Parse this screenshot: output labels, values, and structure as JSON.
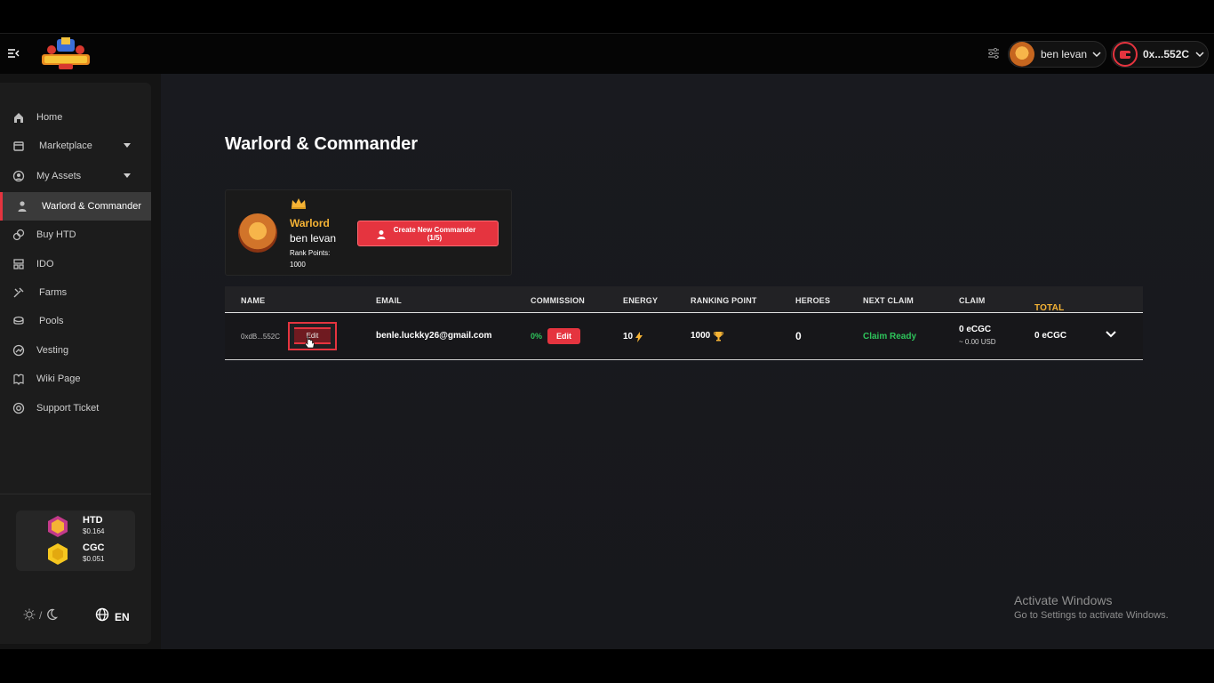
{
  "topbar": {
    "logo_text": "HEROES TD",
    "user_name": "ben levan",
    "wallet_address": "0x...552C"
  },
  "sidebar": {
    "items": [
      {
        "label": "Home",
        "icon": "home-icon"
      },
      {
        "label": "Marketplace",
        "icon": "store-icon"
      },
      {
        "label": "My Assets",
        "icon": "user-circle-icon"
      },
      {
        "label": "Warlord & Commander",
        "icon": "person-icon"
      },
      {
        "label": "Buy HTD",
        "icon": "coins-icon"
      },
      {
        "label": "IDO",
        "icon": "ido-icon"
      },
      {
        "label": "Farms",
        "icon": "tools-icon"
      },
      {
        "label": "Pools",
        "icon": "pool-icon"
      },
      {
        "label": "Vesting",
        "icon": "vesting-icon"
      },
      {
        "label": "Wiki Page",
        "icon": "book-icon"
      },
      {
        "label": "Support Ticket",
        "icon": "lifebuoy-icon"
      }
    ],
    "tokens": [
      {
        "name": "HTD",
        "price": "$0.164"
      },
      {
        "name": "CGC",
        "price": "$0.051"
      }
    ],
    "theme_separator": "/",
    "language": "EN"
  },
  "page": {
    "title": "Warlord & Commander"
  },
  "warlord_card": {
    "rank": "Warlord",
    "user_name": "ben levan",
    "rank_points_label": "Rank Points:",
    "rank_points_value": "1000",
    "create_button_line1": "Create New Commander",
    "create_button_line2": "(1/5)"
  },
  "table": {
    "headers": {
      "name": "NAME",
      "email": "EMAIL",
      "commission": "COMMISSION",
      "energy": "ENERGY",
      "ranking_point": "RANKING POINT",
      "heroes": "HEROES",
      "next_claim": "NEXT CLAIM",
      "claim": "CLAIM",
      "total": "TOTAL"
    },
    "row": {
      "address": "0xdB...552C",
      "edit_label": "Edit",
      "email": "benle.luckky26@gmail.com",
      "commission": "0%",
      "commission_edit": "Edit",
      "energy": "10",
      "ranking_point": "1000",
      "heroes": "0",
      "next_claim": "Claim Ready",
      "claim_amount": "0 eCGC",
      "claim_usd": "~ 0.00 USD",
      "total": "0 eCGC"
    }
  },
  "watermark": {
    "line1": "Activate Windows",
    "line2": "Go to Settings to activate Windows."
  },
  "colors": {
    "accent": "#e5343f",
    "gold": "#f5b335",
    "green": "#2ec45b"
  }
}
